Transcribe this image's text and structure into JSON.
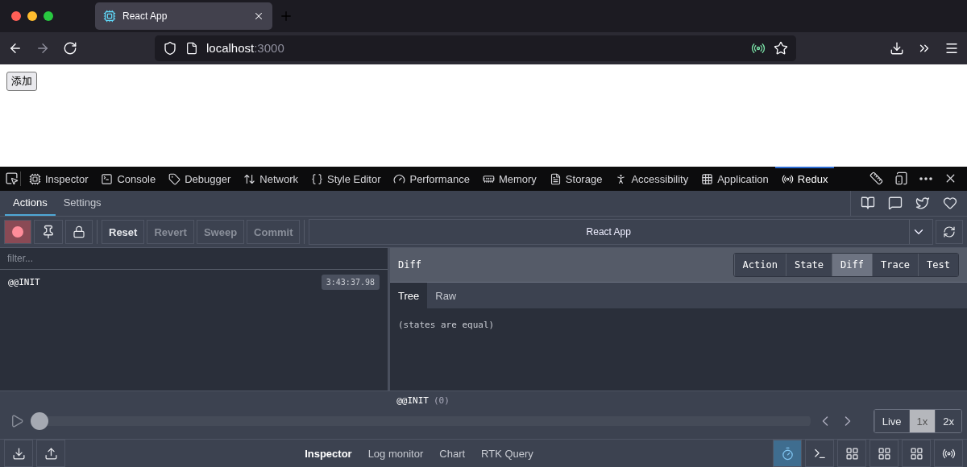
{
  "browser": {
    "tabs": [
      {
        "title": "React App",
        "selected": true
      }
    ],
    "url": {
      "host": "localhost",
      "port": ":3000"
    }
  },
  "page": {
    "button": "添加"
  },
  "devtools": {
    "tools": [
      {
        "label": "Inspector",
        "selected": false
      },
      {
        "label": "Console",
        "selected": false
      },
      {
        "label": "Debugger",
        "selected": false
      },
      {
        "label": "Network",
        "selected": false
      },
      {
        "label": "Style Editor",
        "selected": false
      },
      {
        "label": "Performance",
        "selected": false
      },
      {
        "label": "Memory",
        "selected": false
      },
      {
        "label": "Storage",
        "selected": false
      },
      {
        "label": "Accessibility",
        "selected": false
      },
      {
        "label": "Application",
        "selected": false
      },
      {
        "label": "Redux",
        "selected": true
      }
    ]
  },
  "redux": {
    "tabs": [
      {
        "label": "Actions",
        "selected": true
      },
      {
        "label": "Settings",
        "selected": false
      }
    ],
    "recording": true,
    "buttons": [
      {
        "label": "Reset",
        "disabled": false
      },
      {
        "label": "Revert",
        "disabled": true
      },
      {
        "label": "Sweep",
        "disabled": true
      },
      {
        "label": "Commit",
        "disabled": true
      }
    ],
    "instance": "React App",
    "filter": {
      "placeholder": "filter..."
    },
    "actions": [
      {
        "type": "@@INIT",
        "time": "3:43:37.98"
      }
    ],
    "panel_title": "Diff",
    "monitor_tabs": [
      {
        "label": "Action",
        "selected": false
      },
      {
        "label": "State",
        "selected": false
      },
      {
        "label": "Diff",
        "selected": true
      },
      {
        "label": "Trace",
        "selected": false
      },
      {
        "label": "Test",
        "selected": false
      }
    ],
    "view_tabs": [
      {
        "label": "Tree",
        "selected": true
      },
      {
        "label": "Raw",
        "selected": false
      }
    ],
    "content": "(states are equal)",
    "slider": {
      "action": "@@INIT",
      "index": "(0)",
      "level": 0
    },
    "speeds": [
      {
        "label": "Live",
        "selected": false
      },
      {
        "label": "1x",
        "selected": true
      },
      {
        "label": "2x",
        "selected": false
      }
    ],
    "monitors": [
      {
        "label": "Inspector",
        "selected": true
      },
      {
        "label": "Log monitor",
        "selected": false
      },
      {
        "label": "Chart",
        "selected": false
      },
      {
        "label": "RTK Query",
        "selected": false
      }
    ],
    "tool_buttons": [
      {
        "selected": true
      },
      {
        "selected": false
      },
      {
        "selected": false
      },
      {
        "selected": false
      },
      {
        "selected": false
      },
      {
        "selected": false
      }
    ]
  }
}
